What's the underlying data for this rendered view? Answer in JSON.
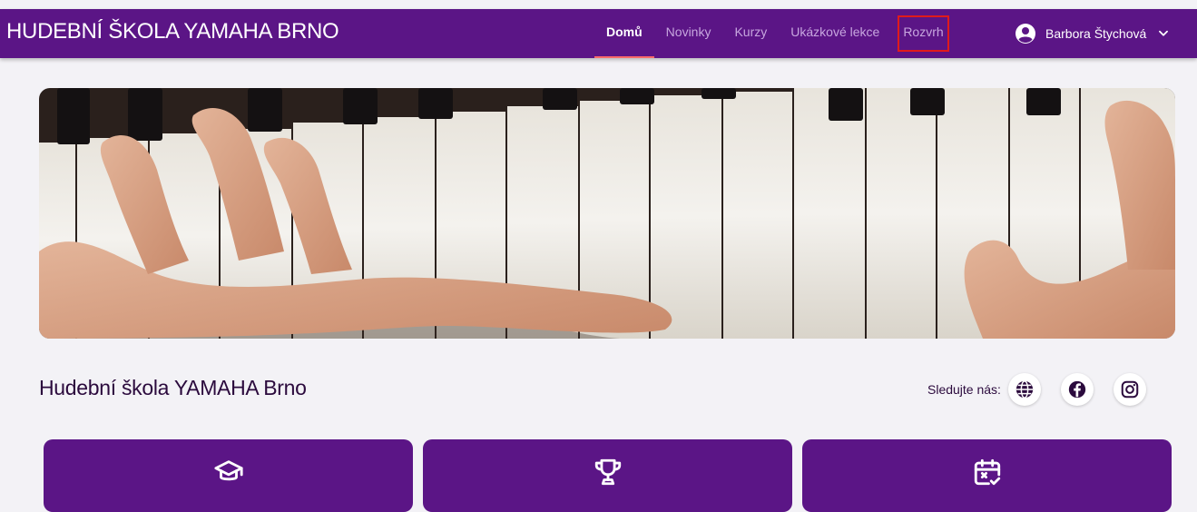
{
  "header": {
    "brand": "HUDEBNÍ ŠKOLA YAMAHA BRNO",
    "nav": [
      {
        "label": "Domů",
        "active": true
      },
      {
        "label": "Novinky",
        "active": false
      },
      {
        "label": "Kurzy",
        "active": false
      },
      {
        "label": "Ukázkové lekce",
        "active": false
      },
      {
        "label": "Rozvrh",
        "active": false,
        "highlighted": true
      }
    ],
    "user_name": "Barbora Štychová",
    "user_icon": "account-circle-icon",
    "menu_icon": "chevron-down-icon"
  },
  "hero": {
    "image": "piano-hands-photo"
  },
  "section": {
    "title": "Hudební škola YAMAHA Brno"
  },
  "follow": {
    "label": "Sledujte nás:",
    "icons": [
      "globe-icon",
      "facebook-icon",
      "instagram-icon"
    ]
  },
  "cards": [
    {
      "icon": "graduation-cap-icon"
    },
    {
      "icon": "trophy-icon"
    },
    {
      "icon": "calendar-check-icon"
    }
  ],
  "colors": {
    "primary": "#5b1586",
    "nav_inactive": "#c7a6df",
    "active_underline": "#ff6a6a",
    "highlight_box": "#e01b1b",
    "background": "#f3f2f6"
  }
}
